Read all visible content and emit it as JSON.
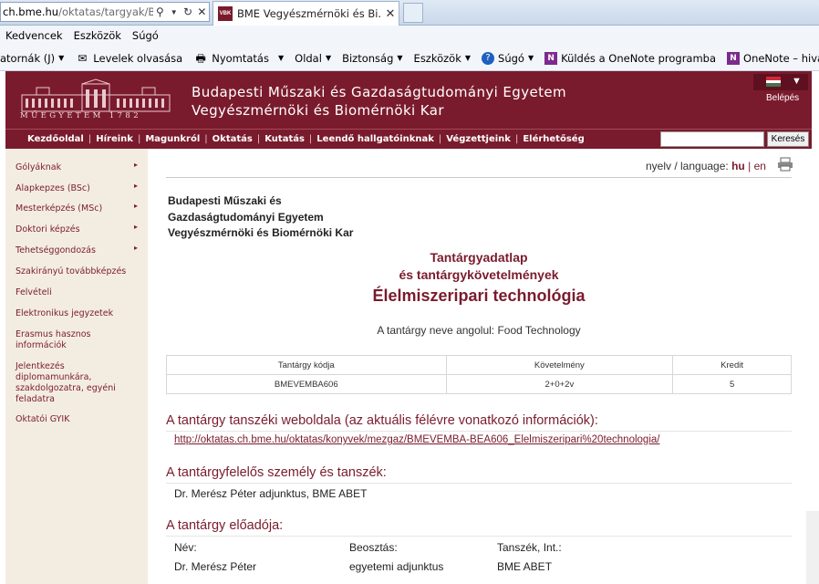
{
  "browser": {
    "address_host": "ch.bme.hu",
    "address_path": "/oktatas/targyak/BMEVI",
    "tab_title": "BME Vegyészmérnöki és Bi...",
    "menu": [
      "Kedvencek",
      "Eszközök",
      "Súgó"
    ],
    "commands": {
      "partial": "atornák (J)",
      "read_mail": "Levelek olvasása",
      "print": "Nyomtatás",
      "page": "Oldal",
      "safety": "Biztonság",
      "tools": "Eszközök",
      "help": "Súgó",
      "onenote_send": "Küldés a OneNote programba",
      "onenote_link": "OneNote – hivatkoz"
    }
  },
  "site": {
    "logo_text": "MŰEGYETEM 1782",
    "university": "Budapesti Műszaki és Gazdaságtudományi Egyetem",
    "faculty": "Vegyészmérnöki és Biomérnöki Kar",
    "login": "Belépés",
    "nav": [
      "Kezdőoldal",
      "Híreink",
      "Magunkról",
      "Oktatás",
      "Kutatás",
      "Leendő hallgatóinknak",
      "Végzettjeink",
      "Elérhetőség"
    ],
    "search_button": "Keresés",
    "colors": {
      "brand": "#7a1b2d",
      "sidebar": "#f3ede1"
    }
  },
  "sidebar": {
    "items": [
      {
        "label": "Gólyáknak",
        "arrow": "▸"
      },
      {
        "label": "Alapkepzes (BSc)",
        "arrow": "▸"
      },
      {
        "label": "Mesterképzés (MSc)",
        "arrow": "▸"
      },
      {
        "label": "Doktori képzés",
        "arrow": "▸"
      },
      {
        "label": "Tehetséggondozás",
        "arrow": "▸"
      },
      {
        "label": "Szakirányú továbbképzés"
      },
      {
        "label": "Felvételi"
      },
      {
        "label": "Elektronikus jegyzetek"
      },
      {
        "label": "Erasmus hasznos információk"
      },
      {
        "label": "Jelentkezés diplomamunkára, szakdolgozatra, egyéni feladatra"
      },
      {
        "label": "Oktatói GYIK"
      }
    ]
  },
  "main": {
    "lang_label": "nyelv / language:",
    "lang_hu": "hu",
    "lang_sep": "|",
    "lang_en": "en",
    "institution": [
      "Budapesti Műszaki és",
      "Gazdaságtudományi Egyetem",
      "Vegyészmérnöki és Biomérnöki Kar"
    ],
    "subtitle1": "Tantárgyadatlap",
    "subtitle2": "és tantárgykövetelmények",
    "course_title": "Élelmiszeripari technológia",
    "english_name": "A tantárgy neve angolul: Food Technology",
    "table": {
      "headers": [
        "Tantárgy kódja",
        "Követelmény",
        "Kredit"
      ],
      "row": [
        "BMEVEMBA606",
        "2+0+2v",
        "5"
      ]
    },
    "sec_website": "A tantárgy tanszéki weboldala (az aktuális félévre vonatkozó információk):",
    "website_url": "http://oktatas.ch.bme.hu/oktatas/konyvek/mezgaz/BMEVEMBA-BEA606_Elelmiszeripari%20technologia/",
    "sec_responsible": "A tantárgyfelelős személy és tanszék:",
    "responsible": "Dr. Merész Péter adjunktus, BME ABET",
    "sec_lecturer": "A tantárgy előadója:",
    "lecturer_headers": [
      "Név:",
      "Beosztás:",
      "Tanszék, Int.:"
    ],
    "lecturer_row": [
      "Dr. Merész Péter",
      "egyetemi adjunktus",
      "BME ABET"
    ]
  }
}
